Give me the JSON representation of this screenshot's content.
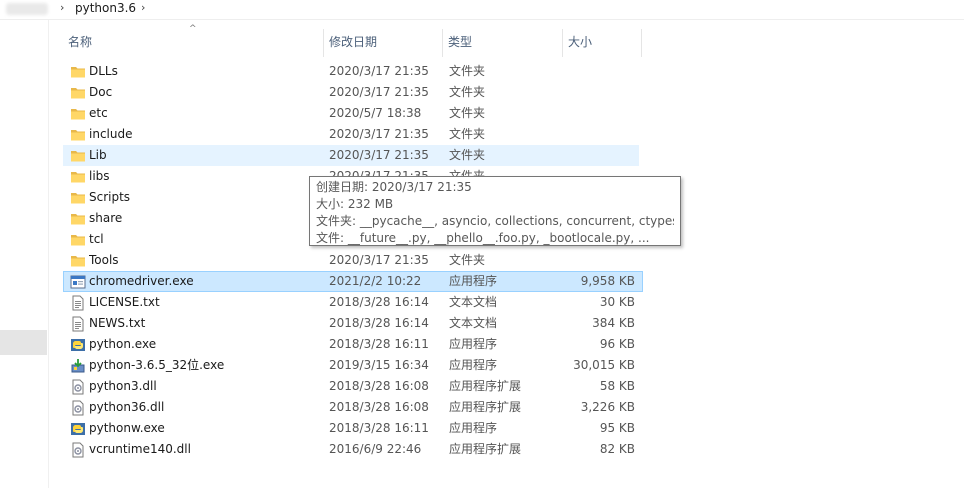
{
  "breadcrumb": {
    "separator": "›",
    "current": "python3.6",
    "chevron": "›"
  },
  "columns": {
    "name": "名称",
    "date": "修改日期",
    "type": "类型",
    "size": "大小"
  },
  "rows": [
    {
      "name": "DLLs",
      "date": "2020/3/17 21:35",
      "type": "文件夹",
      "size": "",
      "icon": "folder-icon"
    },
    {
      "name": "Doc",
      "date": "2020/3/17 21:35",
      "type": "文件夹",
      "size": "",
      "icon": "folder-icon"
    },
    {
      "name": "etc",
      "date": "2020/5/7 18:38",
      "type": "文件夹",
      "size": "",
      "icon": "folder-icon"
    },
    {
      "name": "include",
      "date": "2020/3/17 21:35",
      "type": "文件夹",
      "size": "",
      "icon": "folder-icon"
    },
    {
      "name": "Lib",
      "date": "2020/3/17 21:35",
      "type": "文件夹",
      "size": "",
      "icon": "folder-icon"
    },
    {
      "name": "libs",
      "date": "2020/3/17 21:35",
      "type": "文件夹",
      "size": "",
      "icon": "folder-icon"
    },
    {
      "name": "Scripts",
      "date": "",
      "type": "",
      "size": "",
      "icon": "folder-icon"
    },
    {
      "name": "share",
      "date": "",
      "type": "",
      "size": "",
      "icon": "folder-icon"
    },
    {
      "name": "tcl",
      "date": "",
      "type": "",
      "size": "",
      "icon": "folder-icon"
    },
    {
      "name": "Tools",
      "date": "2020/3/17 21:35",
      "type": "文件夹",
      "size": "",
      "icon": "folder-icon"
    },
    {
      "name": "chromedriver.exe",
      "date": "2021/2/2 10:22",
      "type": "应用程序",
      "size": "9,958 KB",
      "icon": "exe-icon"
    },
    {
      "name": "LICENSE.txt",
      "date": "2018/3/28 16:14",
      "type": "文本文档",
      "size": "30 KB",
      "icon": "text-file-icon"
    },
    {
      "name": "NEWS.txt",
      "date": "2018/3/28 16:14",
      "type": "文本文档",
      "size": "384 KB",
      "icon": "text-file-icon"
    },
    {
      "name": "python.exe",
      "date": "2018/3/28 16:11",
      "type": "应用程序",
      "size": "96 KB",
      "icon": "python-exe-icon"
    },
    {
      "name": "python-3.6.5_32位.exe",
      "date": "2019/3/15 16:34",
      "type": "应用程序",
      "size": "30,015 KB",
      "icon": "installer-icon"
    },
    {
      "name": "python3.dll",
      "date": "2018/3/28 16:08",
      "type": "应用程序扩展",
      "size": "58 KB",
      "icon": "dll-icon"
    },
    {
      "name": "python36.dll",
      "date": "2018/3/28 16:08",
      "type": "应用程序扩展",
      "size": "3,226 KB",
      "icon": "dll-icon"
    },
    {
      "name": "pythonw.exe",
      "date": "2018/3/28 16:11",
      "type": "应用程序",
      "size": "95 KB",
      "icon": "python-exe-icon"
    },
    {
      "name": "vcruntime140.dll",
      "date": "2016/6/9 22:46",
      "type": "应用程序扩展",
      "size": "82 KB",
      "icon": "dll-icon"
    }
  ],
  "tooltip": {
    "created": "创建日期: 2020/3/17 21:35",
    "size": "大小: 232 MB",
    "folders": "文件夹: __pycache__, asyncio, collections, concurrent, ctypes, ...",
    "files": "文件: __future__.py, __phello__.foo.py, _bootlocale.py, ..."
  },
  "colors": {
    "selection": "#cce8ff",
    "hover": "#e5f3ff",
    "folder": "#ffd767",
    "header_text": "#4c607a"
  }
}
